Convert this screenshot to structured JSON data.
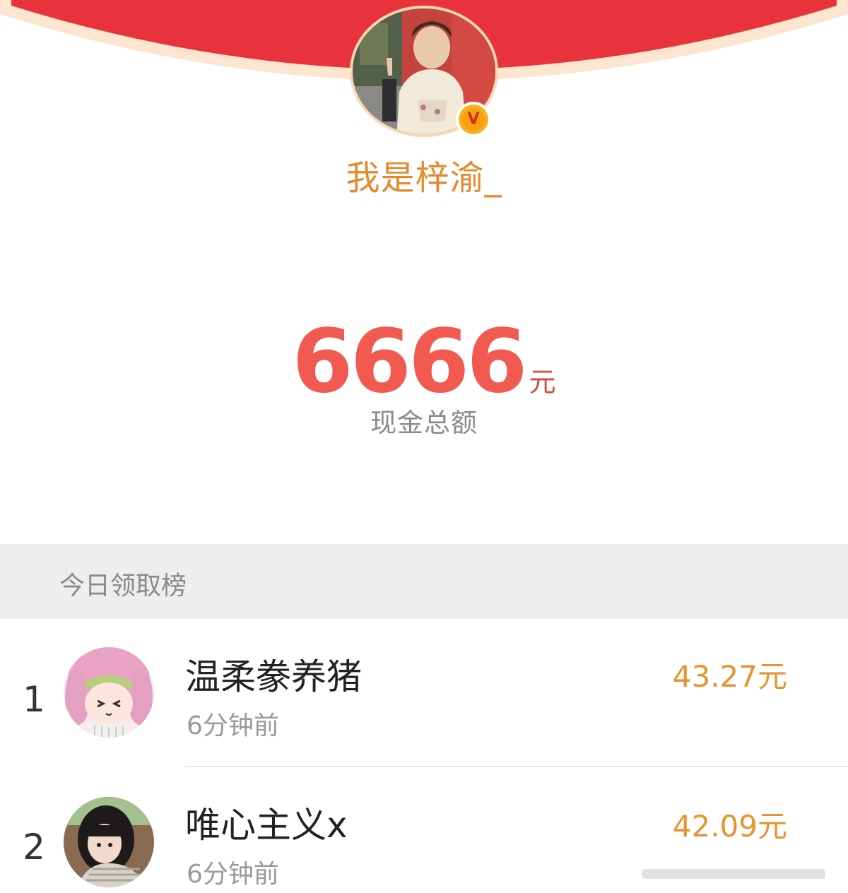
{
  "profile": {
    "username": "我是梓渝_",
    "verified_icon": "verified-v-icon",
    "verified_letter": "V"
  },
  "balance": {
    "amount": "6666",
    "unit": "元",
    "label": "现金总额"
  },
  "leaderboard": {
    "title": "今日领取榜",
    "rows": [
      {
        "rank": "1",
        "name": "温柔豢养猪",
        "time": "6分钟前",
        "amount": "43.27元"
      },
      {
        "rank": "2",
        "name": "唯心主义x",
        "time": "6分钟前",
        "amount": "42.09元"
      }
    ]
  },
  "colors": {
    "banner_red": "#e8323c",
    "banner_border": "#fde6cf",
    "username_orange": "#e48a2e",
    "amount_red": "#f15a50",
    "row_amount_orange": "#e89330",
    "section_bg": "#eeeeee"
  }
}
